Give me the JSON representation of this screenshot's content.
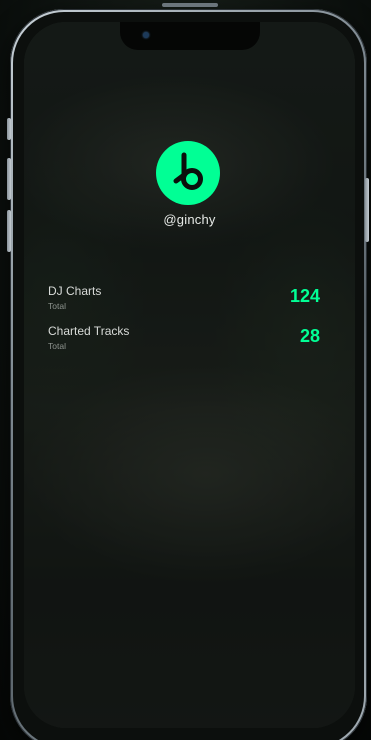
{
  "profile": {
    "username": "@ginchy",
    "logo_icon": "beatport-logo-icon",
    "accent_color": "#01ff95"
  },
  "stats": [
    {
      "label": "DJ Charts",
      "sublabel": "Total",
      "value": "124"
    },
    {
      "label": "Charted Tracks",
      "sublabel": "Total",
      "value": "28"
    }
  ]
}
